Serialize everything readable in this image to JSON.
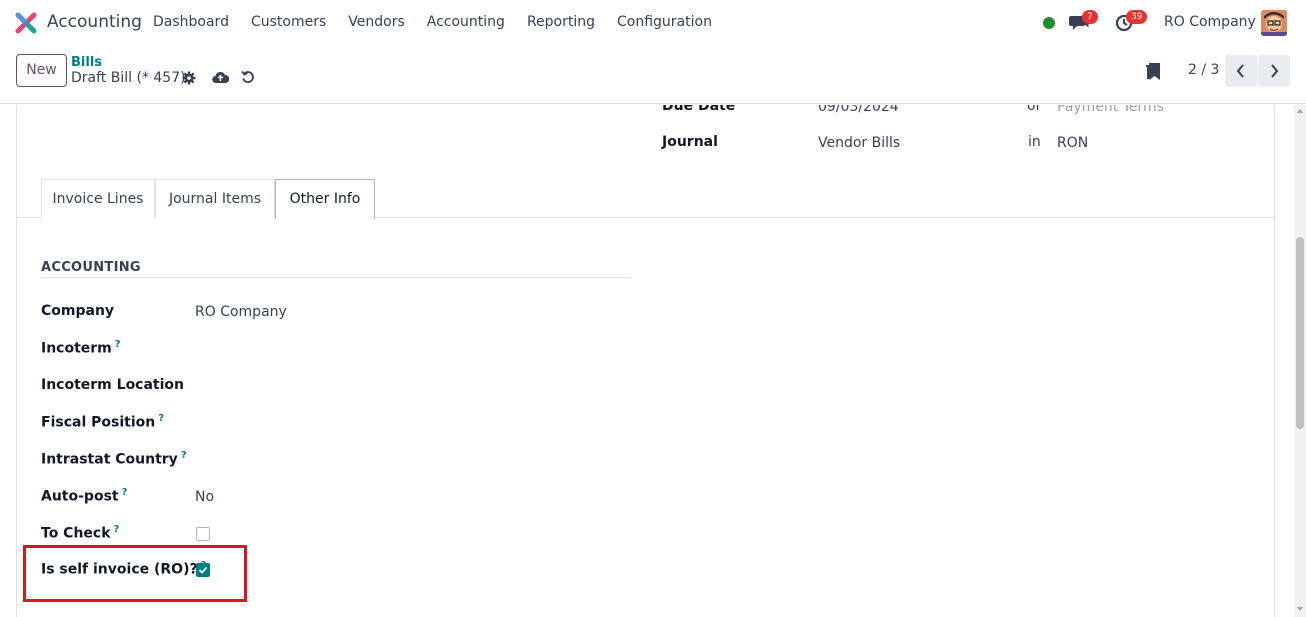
{
  "navbar": {
    "app_name": "Accounting",
    "menu": [
      "Dashboard",
      "Customers",
      "Vendors",
      "Accounting",
      "Reporting",
      "Configuration"
    ],
    "chat_count": "7",
    "activity_count": "39",
    "company": "RO Company"
  },
  "control": {
    "new_label": "New",
    "breadcrumb": "Bills",
    "record_title": "Draft Bill (* 457)",
    "pager": "2 / 3"
  },
  "header_fields": {
    "due_date_label": "Due Date",
    "due_date_value": "09/03/2024",
    "or_label": "or",
    "payment_terms_placeholder": "Payment Terms",
    "journal_label": "Journal",
    "journal_value": "Vendor Bills",
    "in_label": "in",
    "currency_value": "RON"
  },
  "tabs": [
    "Invoice Lines",
    "Journal Items",
    "Other Info"
  ],
  "accounting": {
    "section_title": "ACCOUNTING",
    "company_label": "Company",
    "company_value": "RO Company",
    "incoterm_label": "Incoterm",
    "incoterm_location_label": "Incoterm Location",
    "fiscal_position_label": "Fiscal Position",
    "intrastat_country_label": "Intrastat Country",
    "auto_post_label": "Auto-post",
    "auto_post_value": "No",
    "to_check_label": "To Check",
    "self_invoice_label": "Is self invoice (RO)?",
    "help_mark": "?"
  },
  "colors": {
    "brand": "#714b67",
    "accent": "#017e84",
    "badge": "#e3342f",
    "highlight": "#e0141b"
  }
}
